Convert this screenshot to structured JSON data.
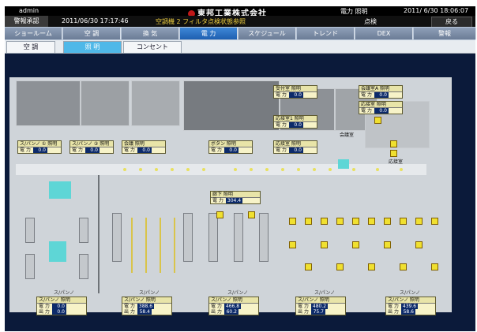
{
  "topbar": {
    "user": "admin",
    "company": "東邦工業株式会社",
    "view_title": "電力 照明",
    "clock": "2011/ 6/30 18:06:07"
  },
  "alarmbar": {
    "label": "警報承認",
    "timestamp": "2011/06/30 17:17:46",
    "message": "空調機 2 フィルタ点検状態参照",
    "check_label": "点検",
    "back_label": "戻る"
  },
  "nav_tabs": [
    {
      "label": "ショールーム"
    },
    {
      "label": "空 調"
    },
    {
      "label": "換 気"
    },
    {
      "label": "電 力"
    },
    {
      "label": "スケジュール"
    },
    {
      "label": "トレンド"
    },
    {
      "label": "DEX"
    },
    {
      "label": "警報"
    }
  ],
  "sub_tabs": [
    {
      "label": "空 調"
    },
    {
      "label": "照 明"
    },
    {
      "label": "コンセント"
    }
  ],
  "panels_top": [
    {
      "title": "ス/パンノ ① 照明",
      "label": "電 力",
      "value": "0.0"
    },
    {
      "title": "ス/パンノ ③ 照明",
      "label": "電 力",
      "value": "0.0"
    },
    {
      "title": "会議 照明",
      "label": "電 力",
      "value": "0.0"
    },
    {
      "title": "ボタン 照明",
      "label": "電 力",
      "value": "0.0"
    },
    {
      "title": "応接室 照明",
      "label": "電 力",
      "value": "0.0"
    }
  ],
  "panels_right": [
    {
      "title": "受付室 照明",
      "label": "電 力",
      "value": "0.0"
    },
    {
      "title": "応接室1 照明",
      "label": "電 力",
      "value": "0.0"
    },
    {
      "title": "会議室A 照明",
      "label": "電 力",
      "value": "0.0"
    },
    {
      "title": "応接室 照明",
      "label": "電 力",
      "value": "0.0"
    }
  ],
  "panel_center": {
    "title": "廊下 照明",
    "label": "電 力",
    "value": "304.4"
  },
  "panels_bottom": [
    {
      "title": "ス/パンノ 照明",
      "l1": "電 力",
      "v1": "0.0",
      "l2": "出 力",
      "v2": "0.0"
    },
    {
      "title": "ス/パンノ 照明",
      "l1": "電 力",
      "v1": "388.6",
      "l2": "出 力",
      "v2": "58.4"
    },
    {
      "title": "ス/パンノ 照明",
      "l1": "電 力",
      "v1": "466.8",
      "l2": "出 力",
      "v2": "60.2"
    },
    {
      "title": "ス/パンノ 照明",
      "l1": "電 力",
      "v1": "480.2",
      "l2": "出 力",
      "v2": "75.7"
    },
    {
      "title": "ス/パンノ 照明",
      "l1": "電 力",
      "v1": "439.6",
      "l2": "出 力",
      "v2": "58.6"
    }
  ],
  "zone_labels": [
    "ス/パンノ",
    "ス/パンノ",
    "ス/パンノ",
    "ス/パンノ",
    "ス/パンノ"
  ],
  "room_labels": {
    "conf": "会議室",
    "reception": "応接室"
  },
  "colors": {
    "active_tab": "#1e5fb0",
    "active_subtab": "#4fb8e8",
    "light_on": "#f0e030",
    "value_bg": "#0c2a6a"
  }
}
